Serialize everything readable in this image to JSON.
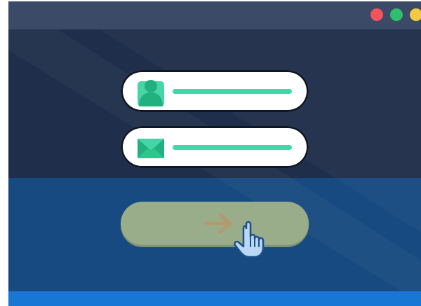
{
  "window": {
    "controls": [
      {
        "name": "close",
        "color": "#f2545b"
      },
      {
        "name": "maximize",
        "color": "#2dbf6c"
      },
      {
        "name": "minimize",
        "color": "#f5c842"
      }
    ]
  },
  "form": {
    "fields": [
      {
        "name": "username",
        "icon": "user-icon",
        "placeholder_color": "#44d6a6"
      },
      {
        "name": "email",
        "icon": "envelope-icon",
        "placeholder_color": "#44d6a6"
      }
    ],
    "submit": {
      "icon": "arrow-right-icon",
      "color": "#99ad8a"
    }
  },
  "cursor": {
    "icon": "hand-pointer-icon"
  },
  "colors": {
    "accent": "#44d6a6",
    "background_top": "#1f2e4a",
    "background_bottom": "#174a80",
    "footer": "#1877d4"
  }
}
